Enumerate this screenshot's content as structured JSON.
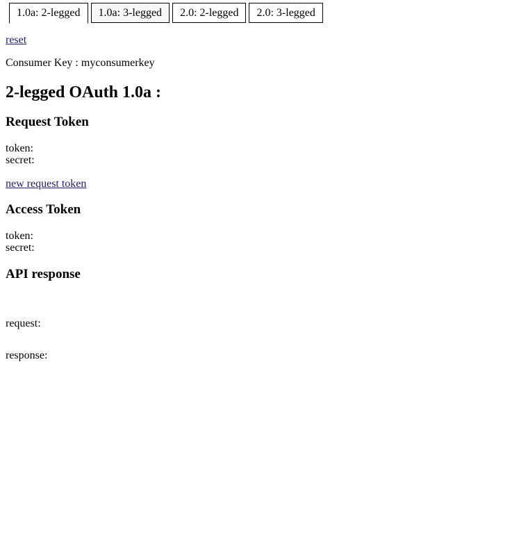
{
  "tabs": [
    {
      "label": "1.0a: 2-legged",
      "active": true
    },
    {
      "label": "1.0a: 3-legged",
      "active": false
    },
    {
      "label": "2.0: 2-legged",
      "active": false
    },
    {
      "label": "2.0: 3-legged",
      "active": false
    }
  ],
  "reset_link": "reset",
  "consumer_key": "Consumer Key : myconsumerkey",
  "page_title": "2-legged OAuth 1.0a :",
  "request_token": {
    "heading": "Request Token",
    "token_label": "token:",
    "secret_label": "secret:",
    "new_link": "new request token"
  },
  "access_token": {
    "heading": "Access Token",
    "token_label": "token:",
    "secret_label": "secret:"
  },
  "api_response": {
    "heading": "API response",
    "request_label": "request:",
    "response_label": "response:"
  }
}
